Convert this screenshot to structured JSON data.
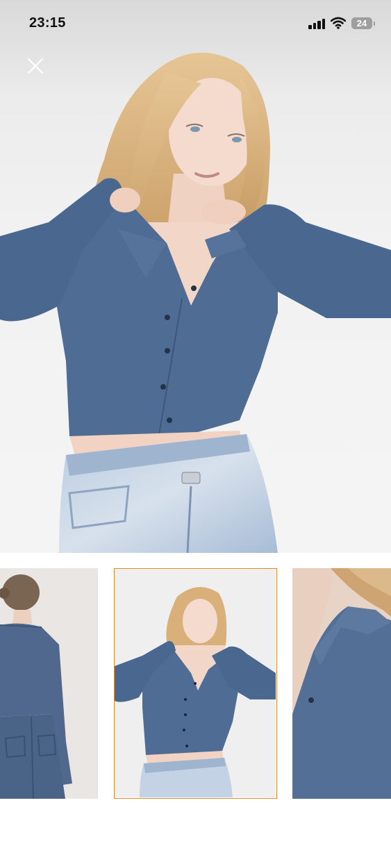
{
  "status_bar": {
    "time": "23:15",
    "battery_level": "24",
    "signal_icon": "cellular-signal-icon",
    "wifi_icon": "wifi-icon"
  },
  "viewer": {
    "close_icon": "close-icon",
    "main_image": "model-front-view-photo",
    "thumbnails": [
      {
        "name": "back-view",
        "selected": false
      },
      {
        "name": "front-view",
        "selected": true
      },
      {
        "name": "collar-detail",
        "selected": false
      }
    ]
  },
  "colors": {
    "accent_selected_border": "#e08a2e",
    "garment_blue": "#4d6a92",
    "background": "#ffffff"
  }
}
